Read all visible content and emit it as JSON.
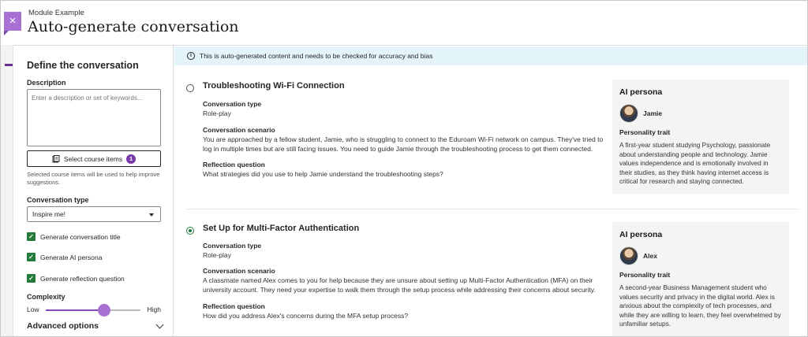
{
  "header": {
    "close_label": "×",
    "module_name": "Module Example",
    "title": "Auto-generate conversation"
  },
  "left_panel": {
    "title": "Define the conversation",
    "description_label": "Description",
    "description_placeholder": "Enter a description or set of keywords...",
    "select_button_label": "Select course items",
    "select_count": "1",
    "select_hint": "Selected course items will be used to help improve suggestions.",
    "conversation_type_label": "Conversation type",
    "conversation_type_value": "Inspire me!",
    "checkboxes": [
      {
        "label": "Generate conversation title",
        "checked": true
      },
      {
        "label": "Generate AI persona",
        "checked": true
      },
      {
        "label": "Generate reflection question",
        "checked": true
      }
    ],
    "complexity_label": "Complexity",
    "complexity_low": "Low",
    "complexity_high": "High",
    "complexity_level": 0.62,
    "advanced_label": "Advanced options"
  },
  "banner": {
    "icon": "info-icon",
    "text": "This is auto-generated content and needs to be checked for accuracy and bias"
  },
  "conversations": [
    {
      "selected": false,
      "title": "Troubleshooting Wi-Fi Connection",
      "type_label": "Conversation type",
      "type_value": "Role-play",
      "scenario_label": "Conversation scenario",
      "scenario": "You are approached by a fellow student, Jamie, who is struggling to connect to the Eduroam Wi-Fi network on campus. They've tried to log in multiple times but are still facing issues. You need to guide Jamie through the troubleshooting process to get them connected.",
      "reflection_label": "Reflection question",
      "reflection": "What strategies did you use to help Jamie understand the troubleshooting steps?",
      "persona": {
        "heading": "AI persona",
        "name": "Jamie",
        "trait_label": "Personality trait",
        "trait": "A first-year student studying Psychology, passionate about understanding people and technology. Jamie values independence and is emotionally involved in their studies, as they think having internet access is critical for research and staying connected."
      }
    },
    {
      "selected": true,
      "title": "Set Up for Multi-Factor Authentication",
      "type_label": "Conversation type",
      "type_value": "Role-play",
      "scenario_label": "Conversation scenario",
      "scenario": "A classmate named Alex comes to you for help because they are unsure about setting up Multi-Factor Authentication (MFA) on their university account. They need your expertise to walk them through the setup process while addressing their concerns about security.",
      "reflection_label": "Reflection question",
      "reflection": "How did you address Alex's concerns during the MFA setup process?",
      "persona": {
        "heading": "AI persona",
        "name": "Alex",
        "trait_label": "Personality trait",
        "trait": "A second-year Business Management student who values security and privacy in the digital world. Alex is anxious about the complexity of tech processes, and while they are willing to learn, they feel overwhelmed by unfamiliar setups."
      }
    }
  ]
}
